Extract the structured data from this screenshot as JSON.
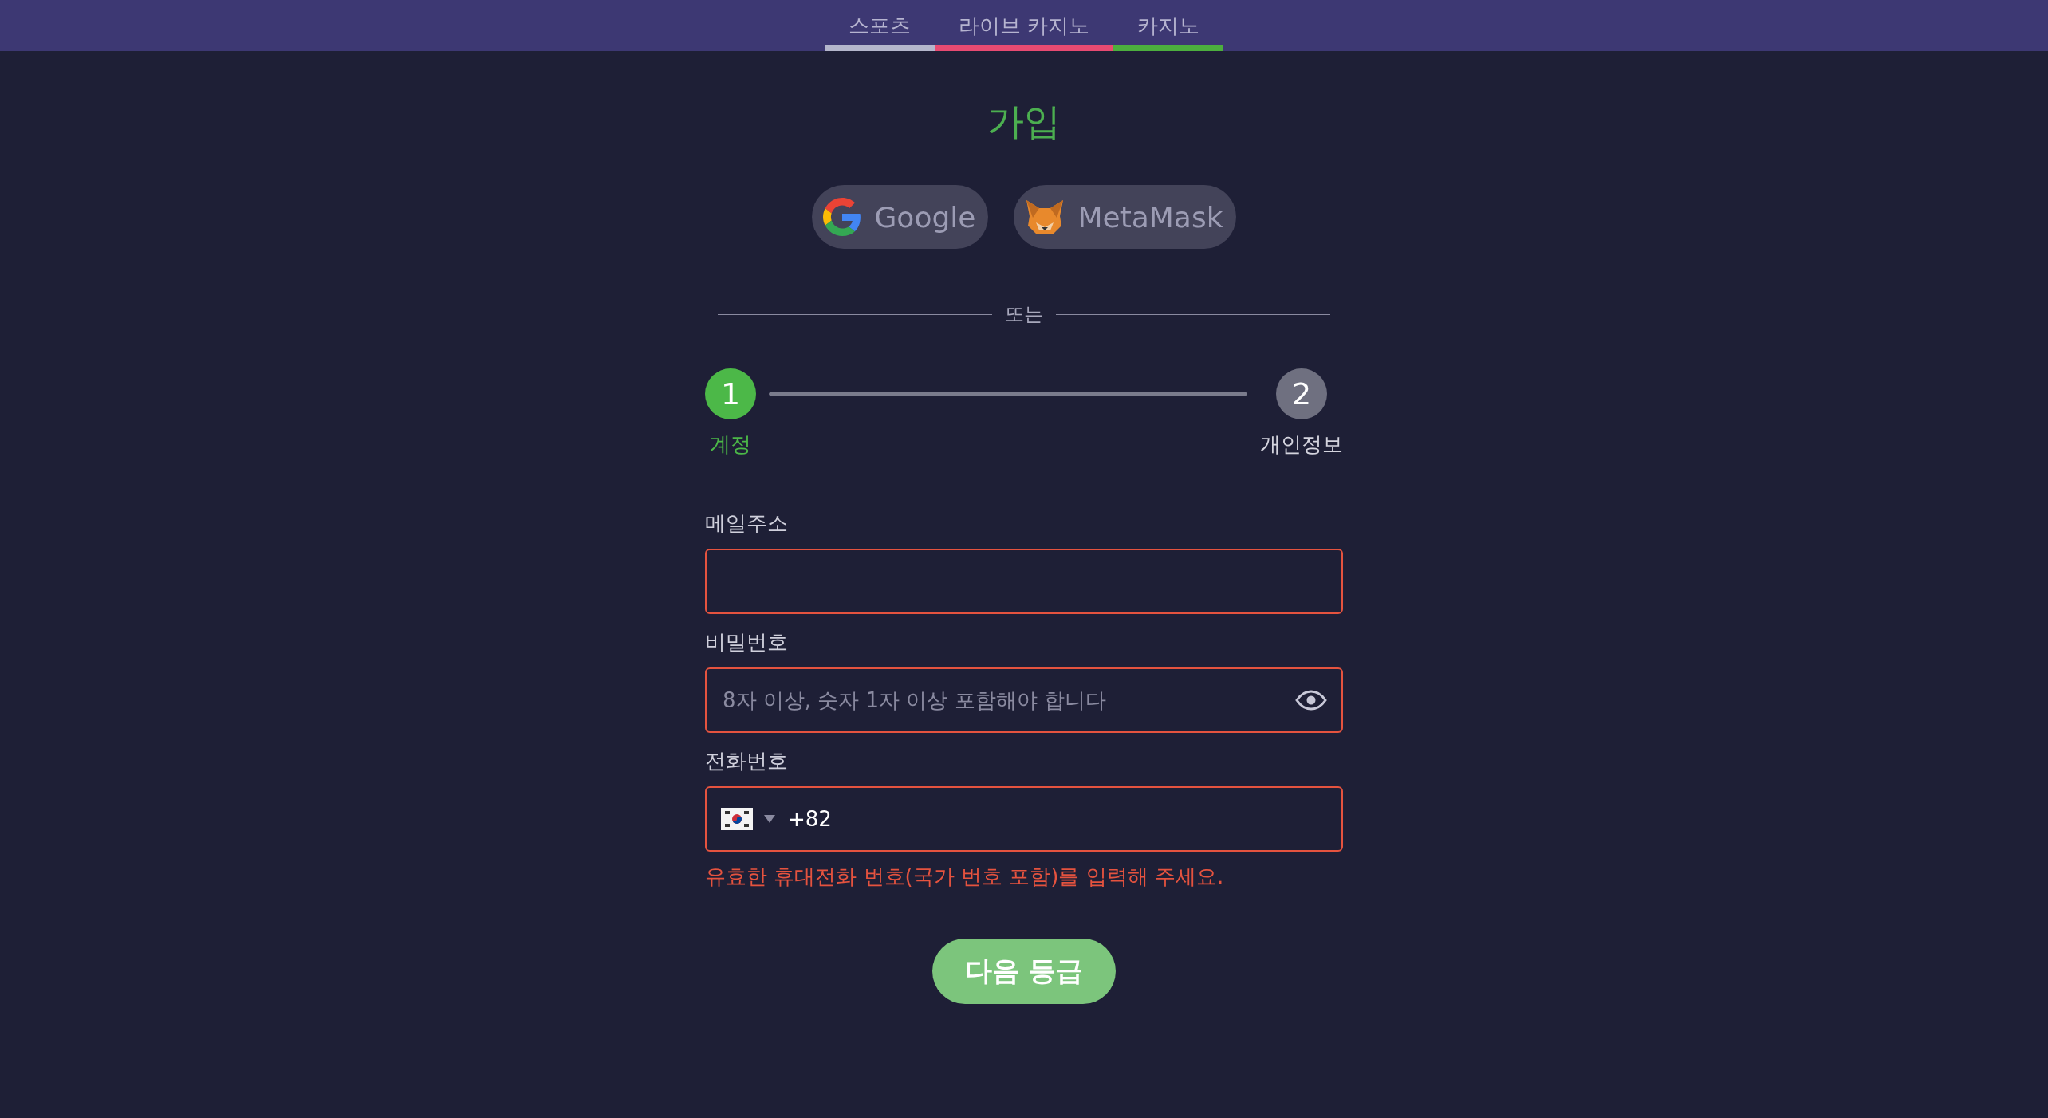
{
  "tabs": [
    {
      "label": "스포츠",
      "color": "#b4b6cc"
    },
    {
      "label": "라이브 카지노",
      "color": "#e84a72"
    },
    {
      "label": "카지노",
      "color": "#4caf3e"
    }
  ],
  "title": "가입",
  "social_buttons": [
    {
      "kind": "google",
      "label": "Google"
    },
    {
      "kind": "metamask",
      "label": "MetaMask"
    }
  ],
  "divider": "또는",
  "steps": [
    {
      "number": "1",
      "label": "계정",
      "selected": true
    },
    {
      "number": "2",
      "label": "개인정보",
      "selected": false
    }
  ],
  "fields": [
    {
      "kind": "email",
      "label": "메일주소",
      "error": true
    },
    {
      "kind": "password",
      "label": "비밀번호",
      "placeholder": "8자 이상, 숫자 1자 이상 포함해야 합니다",
      "error": true
    },
    {
      "kind": "phone",
      "label": "전화번호",
      "value": "+82",
      "error": true,
      "message": "유효한 휴대전화 번호(국가 번호 포함)를 입력해 주세요."
    }
  ],
  "submit": "다음 등급"
}
